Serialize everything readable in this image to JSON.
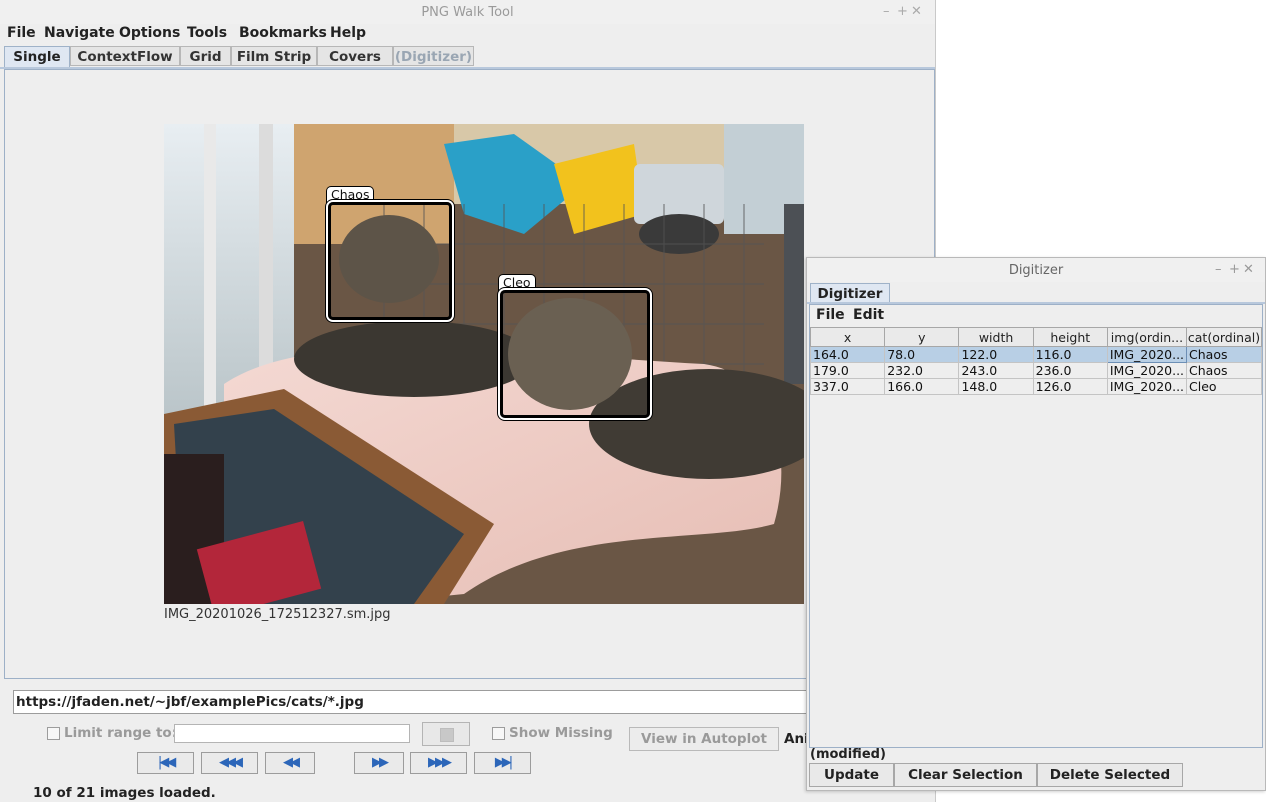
{
  "main_window": {
    "title": "PNG Walk Tool",
    "controls": [
      "–",
      "+",
      "✕"
    ]
  },
  "menu": [
    "File",
    "Navigate",
    "Options",
    "Tools",
    "Bookmarks",
    "Help"
  ],
  "tabs": [
    {
      "label": "Single",
      "active": true
    },
    {
      "label": "ContextFlow"
    },
    {
      "label": "Grid"
    },
    {
      "label": "Film Strip"
    },
    {
      "label": "Covers"
    },
    {
      "label": "(Digitizer)",
      "disabled": true
    }
  ],
  "image": {
    "caption": "IMG_20201026_172512327.sm.jpg",
    "annotations": [
      "Chaos",
      "Cleo"
    ]
  },
  "url": "https://jfaden.net/~jbf/examplePics/cats/*.jpg",
  "controls": {
    "limit_label": "Limit range to:",
    "show_missing_label": "Show Missing",
    "autoplot_button": "View in Autoplot",
    "ani_label": "Ani"
  },
  "nav_buttons": [
    {
      "name": "first",
      "glyph": "|◀◀"
    },
    {
      "name": "prev-page",
      "glyph": "◀◀◀"
    },
    {
      "name": "prev",
      "glyph": "◀◀"
    },
    {
      "name": "next",
      "glyph": "▶▶"
    },
    {
      "name": "next-page",
      "glyph": "▶▶▶"
    },
    {
      "name": "last",
      "glyph": "▶▶|"
    }
  ],
  "status": "10 of 21 images loaded.",
  "digitizer": {
    "title": "Digitizer",
    "controls": [
      "–",
      "+",
      "✕"
    ],
    "tab": "Digitizer",
    "menu": [
      "File",
      "Edit"
    ],
    "columns": [
      "x",
      "y",
      "width",
      "height",
      "img(ordin...",
      "cat(ordinal)"
    ],
    "rows": [
      [
        "164.0",
        "78.0",
        "122.0",
        "116.0",
        "IMG_2020...",
        "Chaos"
      ],
      [
        "179.0",
        "232.0",
        "243.0",
        "236.0",
        "IMG_2020...",
        "Chaos"
      ],
      [
        "337.0",
        "166.0",
        "148.0",
        "126.0",
        "IMG_2020...",
        "Cleo"
      ]
    ],
    "selected_row": 0,
    "status": "(modified)",
    "buttons": [
      "Update",
      "Clear Selection",
      "Delete Selected"
    ]
  }
}
